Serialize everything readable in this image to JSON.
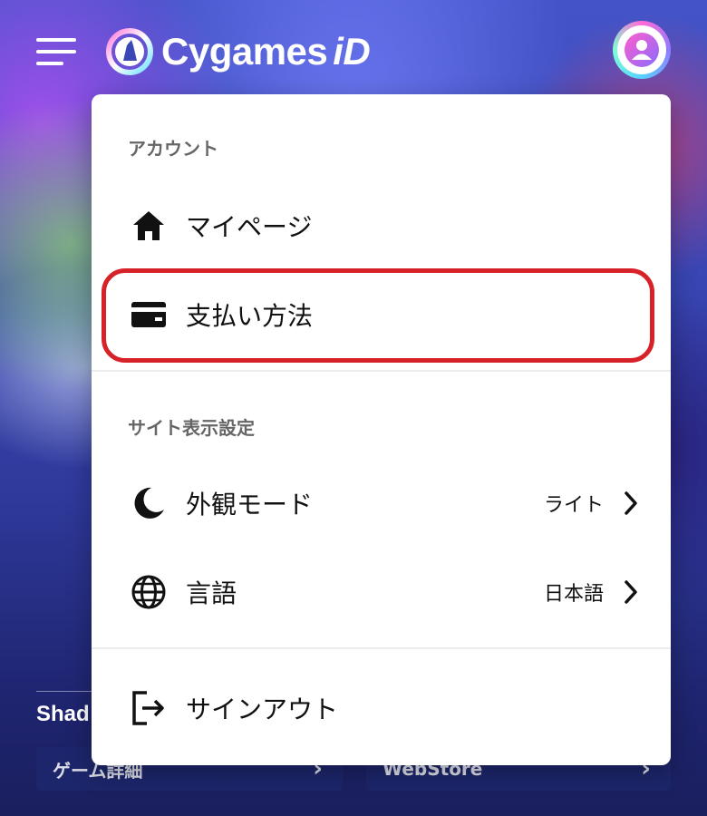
{
  "header": {
    "logo_text": "Cygames",
    "logo_id": "iD"
  },
  "background": {
    "section_title": "Shad",
    "buttons": [
      {
        "label": "ゲーム詳細"
      },
      {
        "label": "WebStore"
      }
    ]
  },
  "menu": {
    "account_label": "アカウント",
    "items_account": [
      {
        "label": "マイページ",
        "icon": "home-icon"
      },
      {
        "label": "支払い方法",
        "icon": "card-icon"
      }
    ],
    "display_label": "サイト表示設定",
    "appearance": {
      "label": "外観モード",
      "value": "ライト",
      "icon": "moon-icon"
    },
    "language": {
      "label": "言語",
      "value": "日本語",
      "icon": "globe-icon"
    },
    "signout": {
      "label": "サインアウト",
      "icon": "sign-out-icon"
    }
  },
  "colors": {
    "highlight": "#d8222a",
    "menu_bg": "#ffffff",
    "avatar_gradient": [
      "#ff6ad5",
      "#8f7bff",
      "#58d2ff"
    ]
  }
}
